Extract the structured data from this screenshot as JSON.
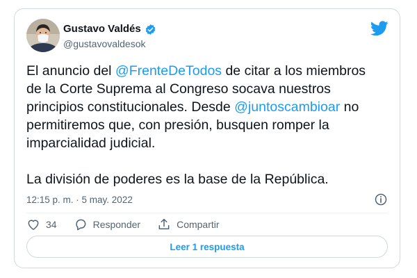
{
  "author": {
    "name": "Gustavo Valdés",
    "handle": "@gustavovaldesok",
    "verified": true
  },
  "tweet": {
    "segments": [
      {
        "text": "El anuncio del ",
        "type": "text"
      },
      {
        "text": "@FrenteDeTodos",
        "type": "mention"
      },
      {
        "text": " de citar a los miembros\nde la Corte Suprema al Congreso socava nuestros\nprincipios constitucionales. Desde ",
        "type": "text"
      },
      {
        "text": "@juntoscambioar",
        "type": "mention"
      },
      {
        "text": " no\npermitiremos que, con presión, busquen romper la\nimparcialidad judicial.",
        "type": "text"
      }
    ],
    "second_paragraph": "La división de poderes es la base de la República.",
    "timestamp": "12:15 p. m. · 5 may. 2022"
  },
  "actions": {
    "like_count": "34",
    "reply_label": "Responder",
    "share_label": "Compartir"
  },
  "read_replies_label": "Leer 1 respuesta",
  "colors": {
    "accent": "#1d9bf0",
    "like_icon": "#536471",
    "border": "#cfd9de"
  },
  "icons": {
    "verified": "verified-badge-icon",
    "brand": "twitter-bird-icon",
    "info": "info-icon",
    "like": "heart-icon",
    "reply": "reply-bubble-icon",
    "share": "share-icon"
  }
}
